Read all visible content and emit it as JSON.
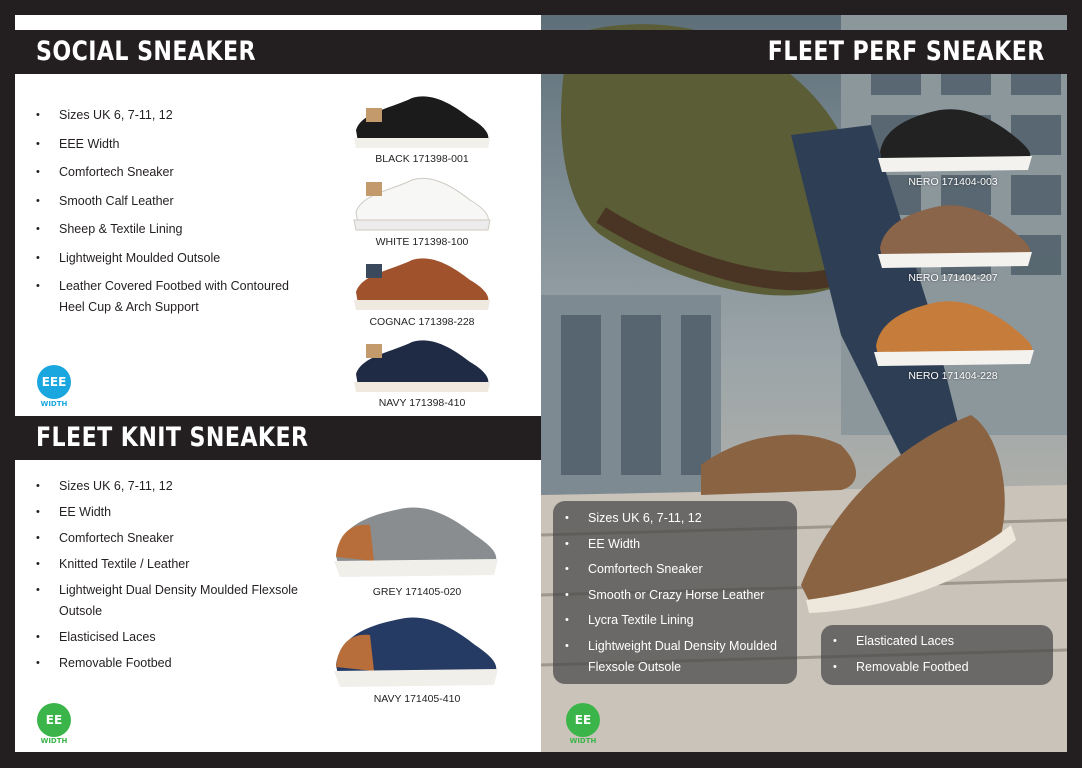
{
  "colors": {
    "header_bg": "#231f20",
    "eee_badge": "#1aa6df",
    "ee_badge": "#3bb54a"
  },
  "social": {
    "title": "SOCIAL SNEAKER",
    "features": [
      "Sizes UK 6, 7-11, 12",
      "EEE Width",
      "Comfortech Sneaker",
      "Smooth Calf Leather",
      "Sheep & Textile Lining",
      "Lightweight Moulded Outsole",
      "Leather Covered Footbed with Contoured Heel Cup & Arch Support"
    ],
    "badge": {
      "code": "EEE",
      "label": "WIDTH"
    },
    "products": [
      "BLACK 171398-001",
      "WHITE 171398-100",
      "COGNAC 171398-228",
      "NAVY 171398-410"
    ]
  },
  "knit": {
    "title": "FLEET KNIT SNEAKER",
    "features": [
      "Sizes UK 6, 7-11, 12",
      "EE Width",
      "Comfortech Sneaker",
      "Knitted Textile / Leather",
      "Lightweight Dual Density Moulded Flexsole Outsole",
      "Elasticised Laces",
      "Removable Footbed"
    ],
    "badge": {
      "code": "EE",
      "label": "WIDTH"
    },
    "products": [
      "GREY 171405-020",
      "NAVY 171405-410"
    ]
  },
  "perf": {
    "title": "FLEET PERF SNEAKER",
    "features": [
      "Sizes UK 6, 7-11, 12",
      "EE Width",
      "Comfortech Sneaker",
      "Smooth or Crazy Horse Leather",
      "Lycra Textile Lining",
      "Lightweight Dual Density Moulded Flexsole Outsole"
    ],
    "features2": [
      "Elasticated Laces",
      "Removable Footbed"
    ],
    "badge": {
      "code": "EE",
      "label": "WIDTH"
    },
    "products": [
      "NERO 171404-003",
      "NERO 171404-207",
      "NERO 171404-228"
    ]
  }
}
